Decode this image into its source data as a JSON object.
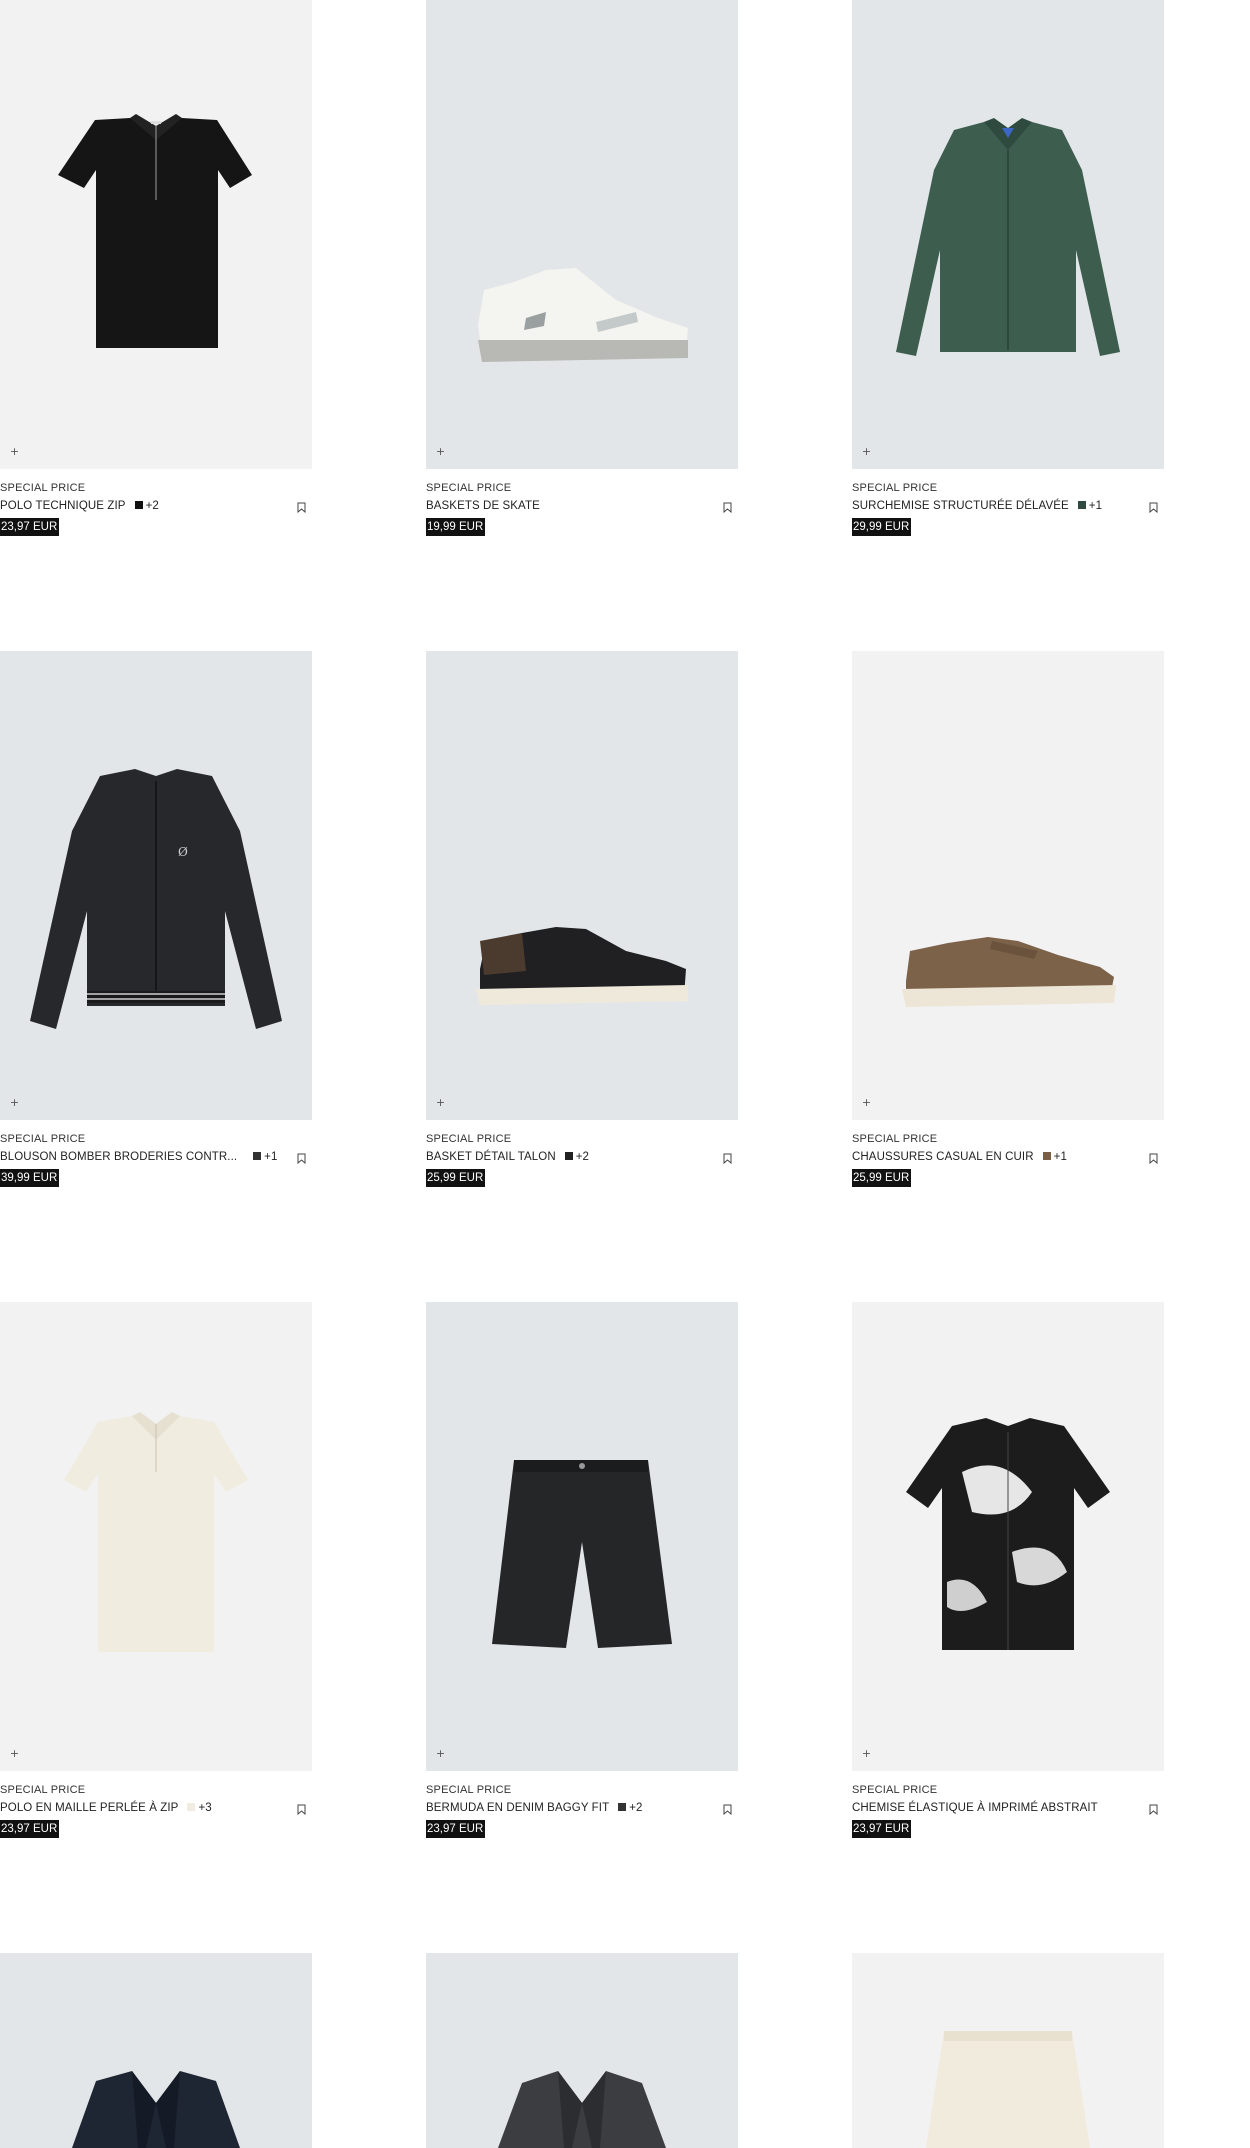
{
  "products": [
    {
      "tag": "SPECIAL PRICE",
      "name": "POLO TECHNIQUE ZIP",
      "swatch_color": "#111111",
      "more": "+2",
      "price": "23,97 EUR",
      "bg": "light",
      "icon": "black-polo-shirt"
    },
    {
      "tag": "SPECIAL PRICE",
      "name": "BASKETS DE SKATE",
      "swatch_color": "",
      "more": "",
      "price": "19,99 EUR",
      "bg": "grey",
      "icon": "white-skate-sneaker"
    },
    {
      "tag": "SPECIAL PRICE",
      "name": "SURCHEMISE STRUCTURÉE DÉLAVÉE",
      "swatch_color": "#2f4a3e",
      "more": "+1",
      "price": "29,99 EUR",
      "bg": "grey",
      "icon": "green-overshirt"
    },
    {
      "tag": "SPECIAL PRICE",
      "name": "BLOUSON BOMBER BRODERIES CONTR...",
      "swatch_color": "#333333",
      "more": "+1",
      "price": "39,99 EUR",
      "bg": "grey",
      "icon": "black-bomber-jacket"
    },
    {
      "tag": "SPECIAL PRICE",
      "name": "BASKET DÉTAIL TALON",
      "swatch_color": "#222222",
      "more": "+2",
      "price": "25,99 EUR",
      "bg": "grey",
      "icon": "black-sneaker"
    },
    {
      "tag": "SPECIAL PRICE",
      "name": "CHAUSSURES CASUAL EN CUIR",
      "swatch_color": "#7a5f45",
      "more": "+1",
      "price": "25,99 EUR",
      "bg": "light",
      "icon": "brown-moccasin-shoe"
    },
    {
      "tag": "SPECIAL PRICE",
      "name": "POLO EN MAILLE PERLÉE À ZIP",
      "swatch_color": "#f1ece0",
      "more": "+3",
      "price": "23,97 EUR",
      "bg": "light",
      "icon": "cream-knit-polo"
    },
    {
      "tag": "SPECIAL PRICE",
      "name": "BERMUDA EN DENIM BAGGY FIT",
      "swatch_color": "#333333",
      "more": "+2",
      "price": "23,97 EUR",
      "bg": "grey",
      "icon": "black-denim-bermuda"
    },
    {
      "tag": "SPECIAL PRICE",
      "name": "CHEMISE ÉLASTIQUE À IMPRIMÉ ABSTRAIT",
      "swatch_color": "",
      "more": "",
      "price": "23,97 EUR",
      "bg": "light",
      "icon": "abstract-print-shirt"
    },
    {
      "tag": "",
      "name": "",
      "swatch_color": "",
      "more": "",
      "price": "",
      "bg": "grey",
      "icon": "navy-blazer"
    },
    {
      "tag": "",
      "name": "",
      "swatch_color": "",
      "more": "",
      "price": "",
      "bg": "grey",
      "icon": "grey-blazer"
    },
    {
      "tag": "",
      "name": "",
      "swatch_color": "",
      "more": "",
      "price": "",
      "bg": "light",
      "icon": "cream-shorts"
    }
  ],
  "ui": {
    "plus_glyph": "+"
  }
}
